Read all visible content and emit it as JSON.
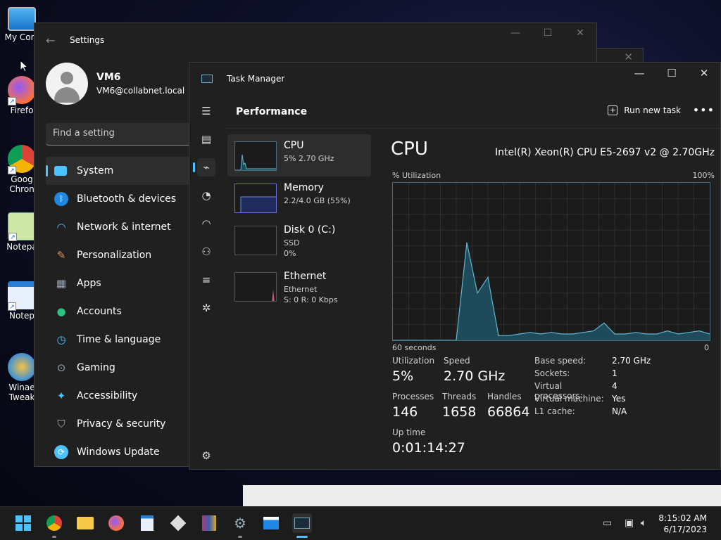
{
  "desktop": {
    "icons": [
      {
        "label": "My Com",
        "icon": "computer-icon"
      },
      {
        "label": "Firefo",
        "icon": "firefox-icon"
      },
      {
        "label": "Goog Chron",
        "icon": "chrome-icon"
      },
      {
        "label": "Notepa",
        "icon": "notepadpp-icon"
      },
      {
        "label": "Notep",
        "icon": "notepad-icon"
      },
      {
        "label": "Winae Tweak",
        "icon": "winaero-icon"
      }
    ]
  },
  "settings": {
    "title": "Settings",
    "user": {
      "name": "VM6",
      "email": "VM6@collabnet.local"
    },
    "search_placeholder": "Find a setting",
    "nav": [
      {
        "label": "System",
        "icon": "system-icon",
        "color": "#4cc2ff",
        "active": true
      },
      {
        "label": "Bluetooth & devices",
        "icon": "bluetooth-icon",
        "color": "#1e88e5"
      },
      {
        "label": "Network & internet",
        "icon": "wifi-icon",
        "color": "#4cc2ff"
      },
      {
        "label": "Personalization",
        "icon": "brush-icon",
        "color": "#e0915a"
      },
      {
        "label": "Apps",
        "icon": "apps-icon",
        "color": "#9aa5b1"
      },
      {
        "label": "Accounts",
        "icon": "person-icon",
        "color": "#2ec27e"
      },
      {
        "label": "Time & language",
        "icon": "globe-clock-icon",
        "color": "#4cc2ff"
      },
      {
        "label": "Gaming",
        "icon": "gamepad-icon",
        "color": "#9aa5b1"
      },
      {
        "label": "Accessibility",
        "icon": "accessibility-icon",
        "color": "#4cc2ff"
      },
      {
        "label": "Privacy & security",
        "icon": "shield-icon",
        "color": "#9aa5b1"
      },
      {
        "label": "Windows Update",
        "icon": "update-icon",
        "color": "#4cc2ff"
      }
    ]
  },
  "taskmanager": {
    "title": "Task Manager",
    "section": "Performance",
    "run_new_task": "Run new task",
    "resources": [
      {
        "name": "CPU",
        "sub1": "5% 2.70 GHz",
        "sub2": ""
      },
      {
        "name": "Memory",
        "sub1": "2.2/4.0 GB (55%)",
        "sub2": ""
      },
      {
        "name": "Disk 0 (C:)",
        "sub1": "SSD",
        "sub2": "0%"
      },
      {
        "name": "Ethernet",
        "sub1": "Ethernet",
        "sub2": "S: 0 R: 0 Kbps"
      }
    ],
    "cpu": {
      "title": "CPU",
      "model": "Intel(R) Xeon(R) CPU E5-2697 v2 @ 2.70GHz",
      "util_label": "% Utilization",
      "max_label": "100%",
      "time_label": "60 seconds",
      "min_label": "0",
      "utilization_label": "Utilization",
      "utilization": "5%",
      "speed_label": "Speed",
      "speed": "2.70 GHz",
      "processes_label": "Processes",
      "processes": "146",
      "threads_label": "Threads",
      "threads": "1658",
      "handles_label": "Handles",
      "handles": "66864",
      "uptime_label": "Up time",
      "uptime": "0:01:14:27",
      "specs": [
        {
          "k": "Base speed:",
          "v": "2.70 GHz"
        },
        {
          "k": "Sockets:",
          "v": "1"
        },
        {
          "k": "Virtual processors:",
          "v": "4"
        },
        {
          "k": "Virtual machine:",
          "v": "Yes"
        },
        {
          "k": "L1 cache:",
          "v": "N/A"
        }
      ]
    }
  },
  "chart_data": {
    "type": "area",
    "xlabel": "60 seconds",
    "ylabel": "% Utilization",
    "ylim": [
      0,
      100
    ],
    "x": [
      60,
      58,
      56,
      54,
      52,
      50,
      48,
      46,
      44,
      42,
      40,
      38,
      36,
      34,
      32,
      30,
      28,
      26,
      24,
      22,
      20,
      18,
      16,
      14,
      12,
      10,
      8,
      6,
      4,
      2,
      0
    ],
    "values": [
      0,
      0,
      0,
      0,
      0,
      0,
      0,
      62,
      30,
      40,
      3,
      3,
      4,
      5,
      4,
      5,
      4,
      4,
      5,
      6,
      11,
      4,
      4,
      5,
      4,
      4,
      6,
      4,
      5,
      6,
      4
    ],
    "colors": {
      "line": "#5fb7d0",
      "fill": "#1f4a5a"
    }
  },
  "taskbar": {
    "apps": [
      {
        "name": "start",
        "icon": "windows-icon"
      },
      {
        "name": "chrome",
        "icon": "chrome-icon"
      },
      {
        "name": "explorer",
        "icon": "folder-icon"
      },
      {
        "name": "firefox",
        "icon": "firefox-icon"
      },
      {
        "name": "notepad",
        "icon": "notepad-icon"
      },
      {
        "name": "app-box",
        "icon": "box-icon"
      },
      {
        "name": "winrar",
        "icon": "archive-icon"
      },
      {
        "name": "settings",
        "icon": "gear-icon"
      },
      {
        "name": "app-window",
        "icon": "window-icon"
      },
      {
        "name": "task-manager",
        "icon": "taskmanager-icon"
      }
    ],
    "time": "8:15:02 AM",
    "date": "6/17/2023"
  }
}
